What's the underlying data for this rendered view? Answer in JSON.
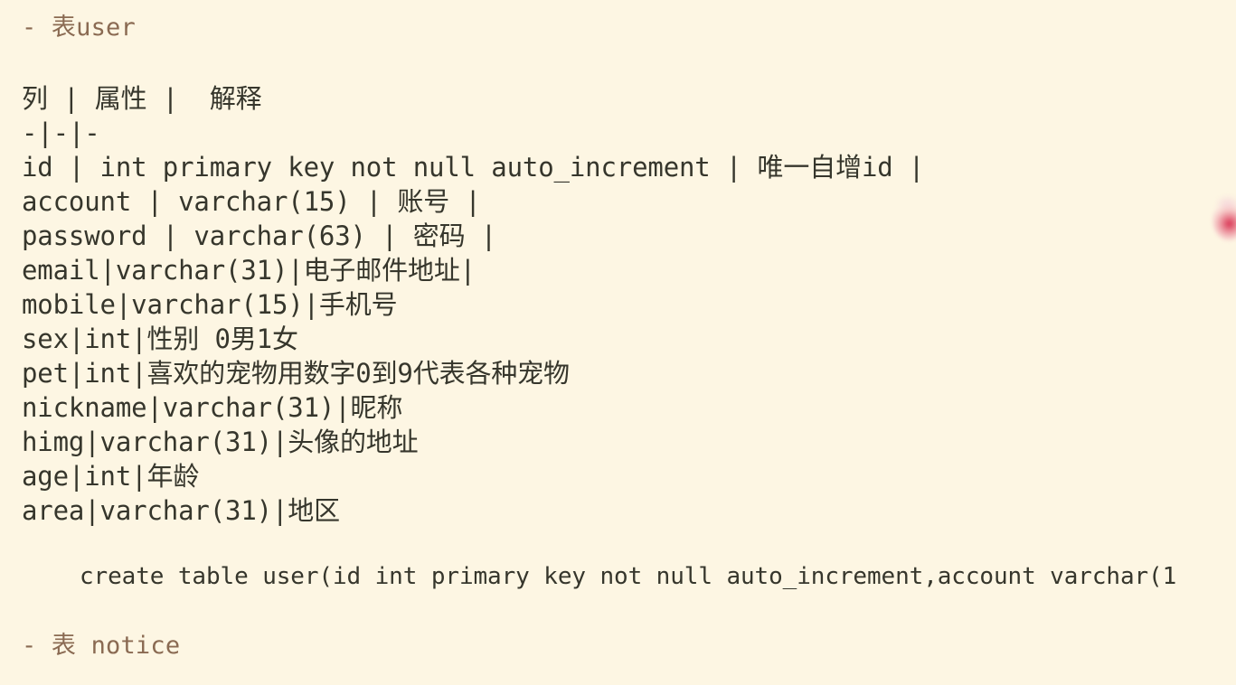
{
  "document": {
    "background_color": "#fdf6e3",
    "text_color": "#36362c",
    "heading_color": "#8a6a52",
    "sections": [
      {
        "heading": "- 表user",
        "table_header": "列 | 属性 |  解释",
        "table_divider": "-|-|-",
        "rows": [
          "id | int primary key not null auto_increment | 唯一自增id |",
          "account | varchar(15) | 账号 |",
          "password | varchar(63) | 密码 |",
          "email|varchar(31)|电子邮件地址|",
          "mobile|varchar(15)|手机号",
          "sex|int|性别 0男1女",
          "pet|int|喜欢的宠物用数字0到9代表各种宠物",
          "nickname|varchar(31)|昵称",
          "himg|varchar(31)|头像的地址",
          "age|int|年龄",
          "area|varchar(31)|地区"
        ],
        "code_block": "create table user(id int primary key not null auto_increment,account varchar(1"
      },
      {
        "heading": "- 表 notice"
      }
    ]
  }
}
